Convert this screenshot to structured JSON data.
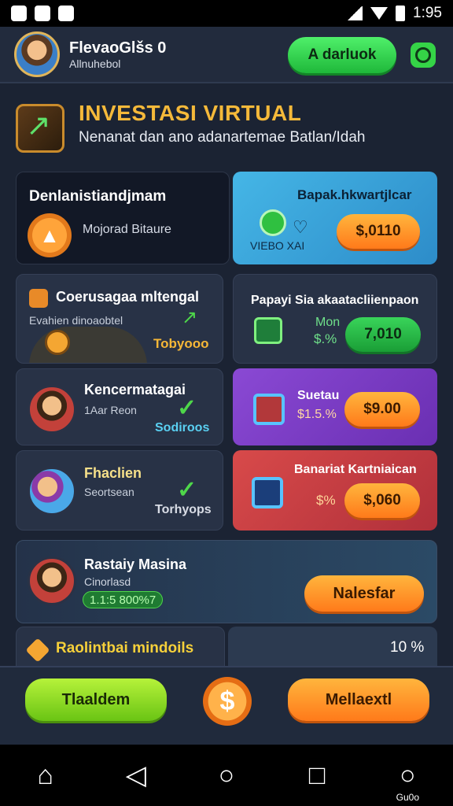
{
  "status": {
    "time": "1:95"
  },
  "header": {
    "name": "FlevaoGlšs 0",
    "sub": "Allnuhebol",
    "action_button": "A darluok"
  },
  "title": {
    "main": "INVESTASI VIRTUAL",
    "subtitle": "Nenanat dan ano adanartemae Batlan/Idah"
  },
  "cards": {
    "c1": {
      "title": "Denlanistiandjmam",
      "label": "Mojorad Bitaure"
    },
    "c2": {
      "title": "Bapak.hkwartjlcar",
      "label": "VIEBO XAI",
      "button": "$,0110"
    },
    "c3": {
      "title": "Coerusagaa mltengal",
      "sub": "Evahien dinoaobtel",
      "tag": "Tobyooo"
    },
    "c4": {
      "title": "Papayi Sia akaatacliienpaon",
      "mon": "Mon",
      "pct": "$.%",
      "button": "7,010"
    },
    "c5": {
      "title": "Kencermatagai",
      "sub": "1Aar Reon",
      "tag": "Sodiroos"
    },
    "c6": {
      "title": "Suetau",
      "pct": "$1.5.%",
      "button": "$9.00"
    },
    "c7": {
      "title": "Fhaclien",
      "sub": "Seortsean",
      "tag": "Torhyops"
    },
    "c8": {
      "title": "Banariat Kartniaican",
      "pct": "$%",
      "button": "$,060"
    },
    "c9": {
      "title": "Rastaiy Masina",
      "sub": "Cinorlasd",
      "badge": "1.1:5 800%7",
      "button": "Nalesfar"
    },
    "c10": {
      "title": "Raolintbai mindoils",
      "value": "10 %"
    }
  },
  "bottom": {
    "left_button": "Tlaaldem",
    "right_button": "Mellaextl",
    "center_icon": "dollar-coin-icon"
  },
  "nav": {
    "last_label": "Gu0o"
  }
}
